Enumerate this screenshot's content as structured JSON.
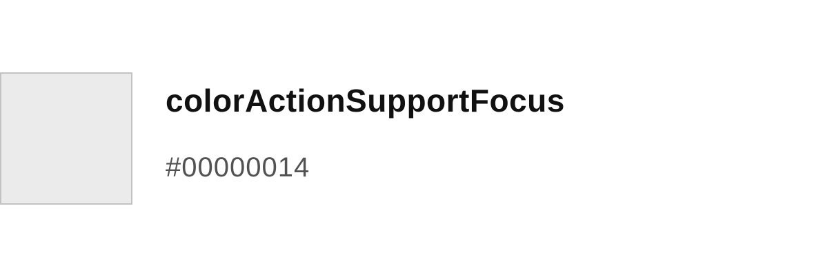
{
  "token": {
    "name": "colorActionSupportFocus",
    "value": "#00000014",
    "swatch_fill": "#ebebeb",
    "swatch_border": "#c2c2c2"
  }
}
